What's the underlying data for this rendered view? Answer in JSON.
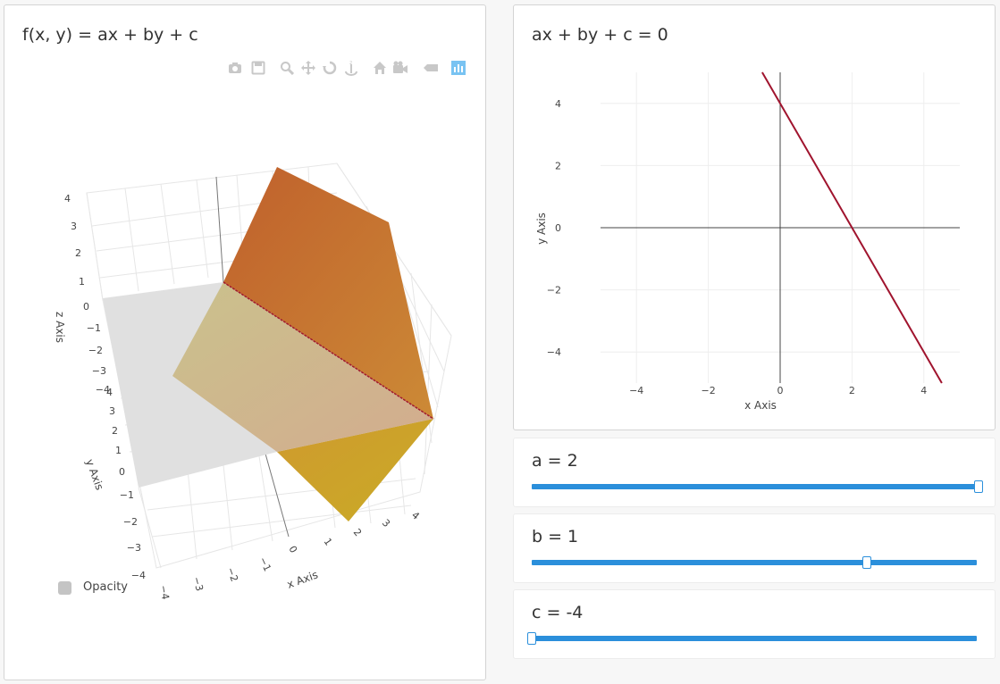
{
  "left_panel": {
    "title": "f(x, y) = ax + by + c",
    "modebar_icons": [
      "camera-icon",
      "save-icon",
      "zoom-icon",
      "pan-icon",
      "orbit-icon",
      "turntable-icon",
      "reset-camera-icon",
      "video-camera-icon",
      "hover-icon",
      "plotly-logo-icon"
    ],
    "axis_labels": {
      "z": "z Axis",
      "y": "y Axis",
      "x": "x Axis"
    },
    "z_ticks": [
      "4",
      "3",
      "2",
      "1",
      "0",
      "−1",
      "−2",
      "−3",
      "−4"
    ],
    "y_ticks": [
      "4",
      "3",
      "2",
      "1",
      "0",
      "−1",
      "−2",
      "−3",
      "−4"
    ],
    "x_ticks": [
      "−4",
      "−3",
      "−2",
      "−1",
      "0",
      "1",
      "2",
      "3",
      "4"
    ],
    "legend": {
      "label": "Opacity",
      "color": "#c4c4c4"
    },
    "surface_colors": {
      "top": "#c0632c",
      "mid": "#c98b3a",
      "bottom": "#c9a82a",
      "plane": "#e0e0e0",
      "intersection": "#a11a2e"
    }
  },
  "right_panel": {
    "title": "ax + by + c = 0",
    "chart_data": {
      "type": "line",
      "series": [
        {
          "x": [
            -0.5,
            4.5
          ],
          "y": [
            5,
            -5
          ],
          "color": "#a0142e"
        }
      ],
      "xlabel": "x Axis",
      "ylabel": "y Axis",
      "xlim": [
        -5,
        5
      ],
      "ylim": [
        -5,
        5
      ],
      "x_ticks": [
        "−4",
        "−2",
        "0",
        "2",
        "4"
      ],
      "y_ticks": [
        "4",
        "2",
        "0",
        "−2",
        "−4"
      ],
      "grid": true
    }
  },
  "sliders": [
    {
      "label": "a = 2",
      "value": 2,
      "min": -2,
      "max": 2
    },
    {
      "label": "b = 1",
      "value": 1,
      "min": -2,
      "max": 2
    },
    {
      "label": "c = -4",
      "value": -4,
      "min": -4,
      "max": 4
    }
  ]
}
